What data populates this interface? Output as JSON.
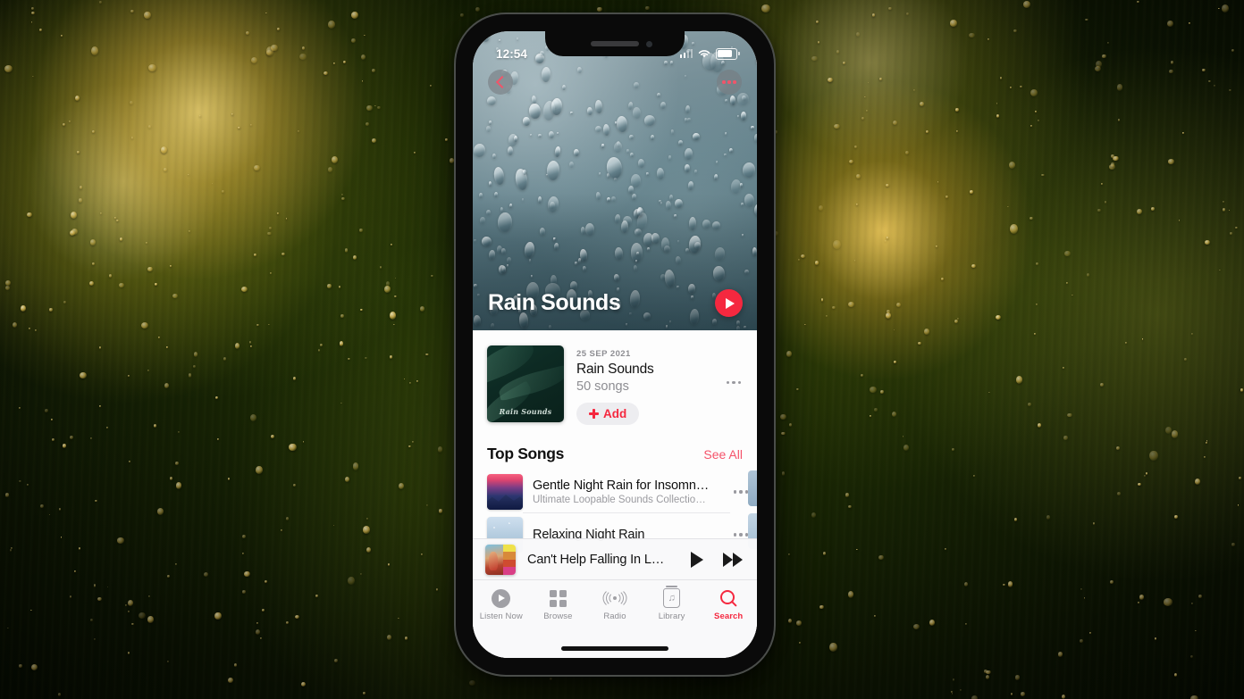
{
  "background": {
    "description": "rain on window with golden bokeh lights",
    "base_color": "#1d2c05",
    "bokeh_color": "#ffd86a"
  },
  "device": {
    "home_indicator": "home-indicator"
  },
  "status_bar": {
    "time": "12:54",
    "cellular": "signal-bars-icon",
    "wifi": "wifi-icon",
    "battery": "battery-icon"
  },
  "hero": {
    "title": "Rain Sounds",
    "back_icon": "chevron-left-icon",
    "more_icon": "ellipsis-icon",
    "play_icon": "play-icon",
    "accent": "#f5283f",
    "artwork": "rain-drops-on-glass"
  },
  "album": {
    "date": "25 SEP 2021",
    "title": "Rain Sounds",
    "song_count": "50 songs",
    "add_label": "Add",
    "add_icon": "plus-icon",
    "more_icon": "ellipsis-icon",
    "artwork_caption": "Rain Sounds"
  },
  "top_songs": {
    "heading": "Top Songs",
    "see_all": "See All",
    "rows": [
      {
        "title": "Gentle Night Rain for Insomn…",
        "subtitle": "Ultimate Loopable Sounds Collectio…",
        "artwork": "mountain-sunset",
        "more_icon": "ellipsis-icon"
      },
      {
        "title": "Relaxing Night Rain",
        "subtitle": "",
        "artwork": "snow-texture",
        "more_icon": "ellipsis-icon"
      }
    ]
  },
  "now_playing": {
    "title": "Can't Help Falling In L…",
    "artwork": "elvis-blue-hawaii",
    "play_icon": "play-icon",
    "next_icon": "fast-forward-icon"
  },
  "tab_bar": {
    "accent": "#f5283f",
    "inactive": "#8e8e93",
    "tabs": [
      {
        "label": "Listen Now",
        "icon": "play-circle-icon",
        "active": false
      },
      {
        "label": "Browse",
        "icon": "grid-squares-icon",
        "active": false
      },
      {
        "label": "Radio",
        "icon": "radio-waves-icon",
        "active": false
      },
      {
        "label": "Library",
        "icon": "music-library-icon",
        "active": false
      },
      {
        "label": "Search",
        "icon": "magnifier-icon",
        "active": true
      }
    ]
  }
}
